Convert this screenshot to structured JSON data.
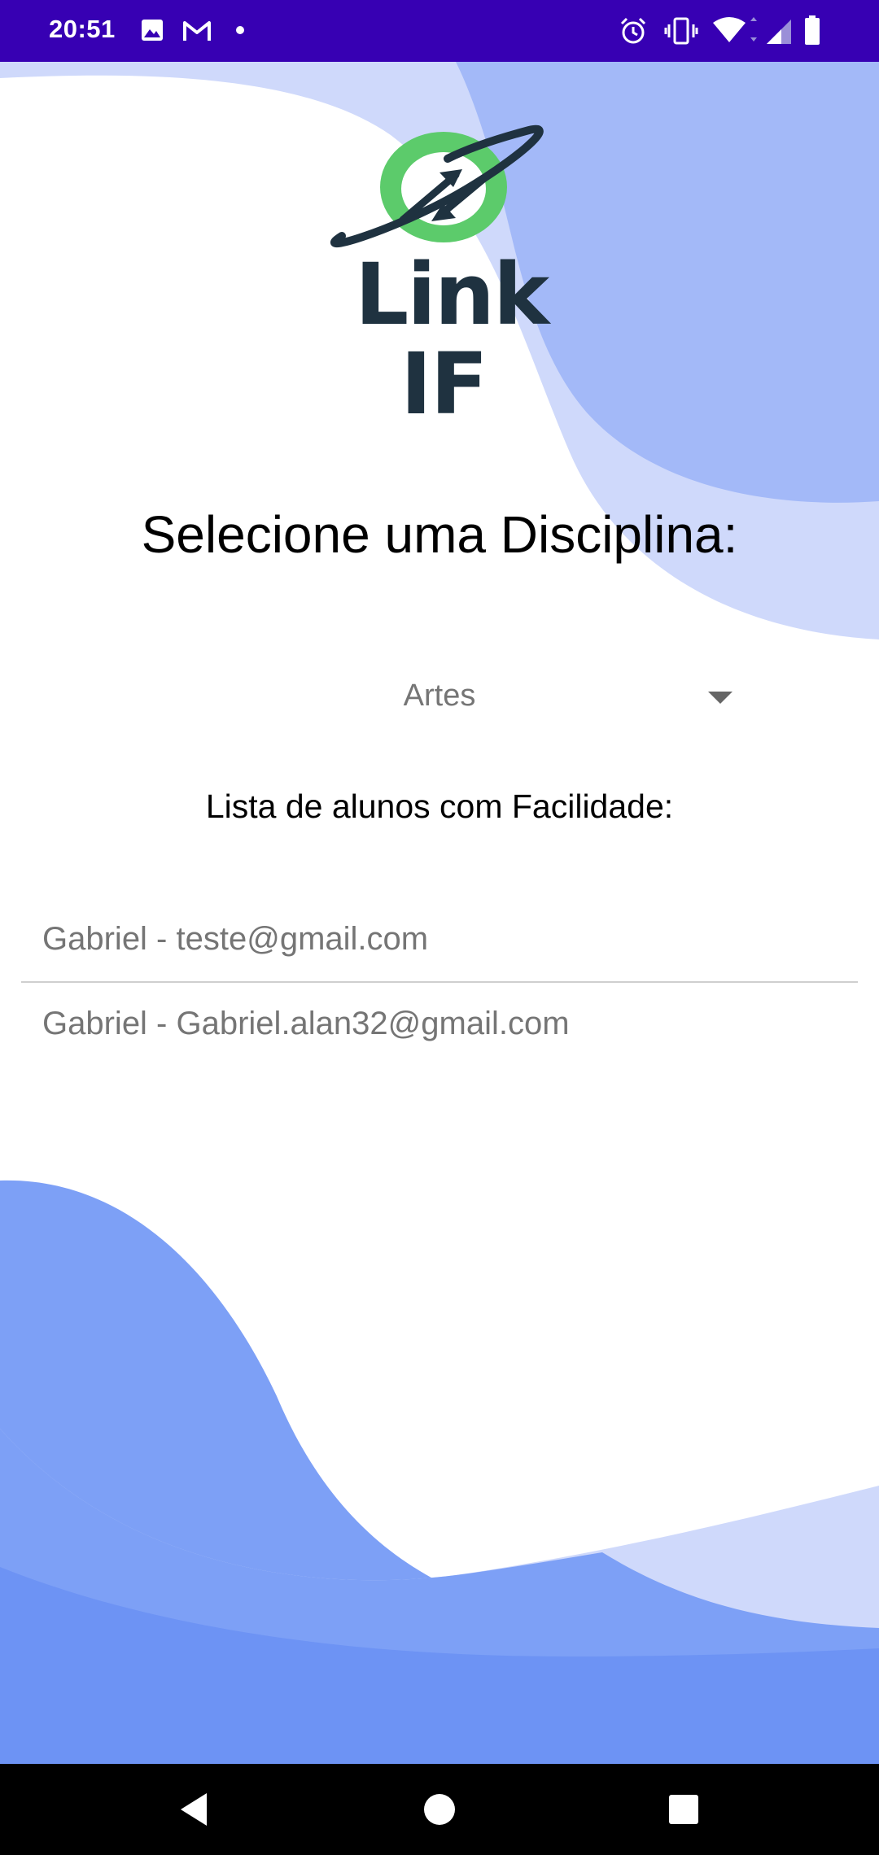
{
  "status_bar": {
    "time": "20:51",
    "left_icons": [
      "image-icon",
      "gmail-icon",
      "dot-icon"
    ],
    "right_icons": [
      "alarm-icon",
      "vibrate-icon",
      "wifi-icon",
      "signal-icon",
      "battery-icon"
    ]
  },
  "logo": {
    "line1": "Link",
    "line2": "IF",
    "colors": {
      "ring": "#5ccb6b",
      "dark": "#1f3240"
    }
  },
  "title": "Selecione uma Disciplina:",
  "spinner": {
    "selected": "Artes"
  },
  "subtitle": "Lista de alunos com Facilidade:",
  "students": [
    "Gabriel  - teste@gmail.com",
    "Gabriel - Gabriel.alan32@gmail.com"
  ],
  "colors": {
    "status_bar": "#3700b3",
    "wave_light": "#cfd9fb",
    "wave_mid": "#a3b9f8",
    "wave_dark": "#6d93f4"
  },
  "nav": [
    "back-icon",
    "home-icon",
    "recents-icon"
  ]
}
